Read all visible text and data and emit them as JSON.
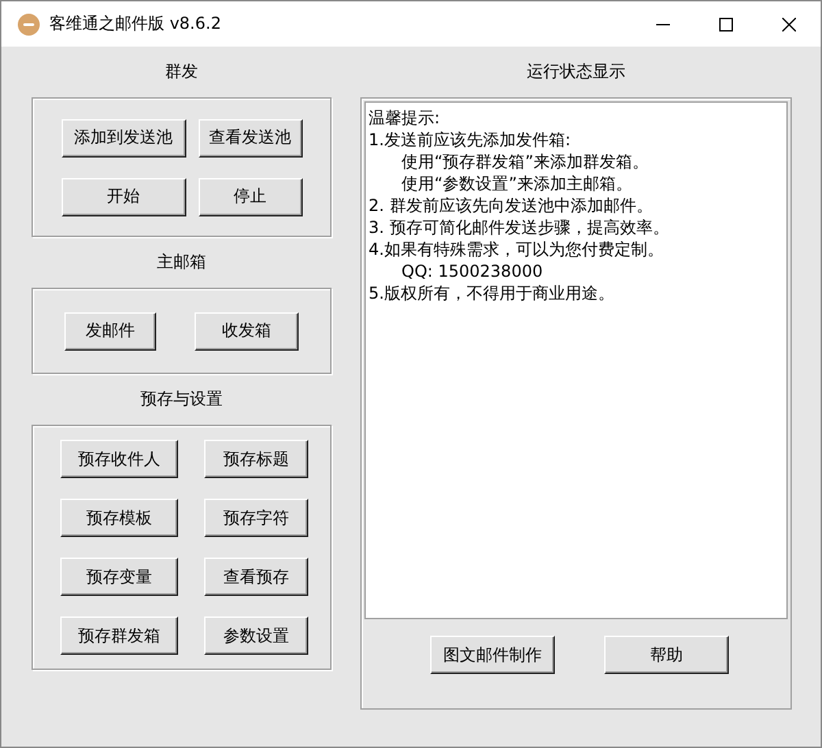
{
  "window": {
    "title": "客维通之邮件版 v8.6.2"
  },
  "left_groups": [
    {
      "title": "群发",
      "buttons": [
        "添加到发送池",
        "查看发送池",
        "开始",
        "停止"
      ]
    },
    {
      "title": "主邮箱",
      "buttons": [
        "发邮件",
        "收发箱"
      ]
    },
    {
      "title": "预存与设置",
      "buttons": [
        "预存收件人",
        "预存标题",
        "预存模板",
        "预存字符",
        "预存变量",
        "查看预存",
        "预存群发箱",
        "参数设置"
      ]
    }
  ],
  "status_panel": {
    "title": "运行状态显示",
    "log_lines": [
      {
        "text": "温馨提示:",
        "indented": false
      },
      {
        "text": "1.发送前应该先添加发件箱:",
        "indented": false
      },
      {
        "text": "使用“预存群发箱”来添加群发箱。",
        "indented": true
      },
      {
        "text": "使用“参数设置”来添加主邮箱。",
        "indented": true
      },
      {
        "text": "2. 群发前应该先向发送池中添加邮件。",
        "indented": false
      },
      {
        "text": "3. 预存可简化邮件发送步骤，提高效率。",
        "indented": false
      },
      {
        "text": "4.如果有特殊需求，可以为您付费定制。",
        "indented": false
      },
      {
        "text": "QQ: 1500238000",
        "indented": true
      },
      {
        "text": "5.版权所有，不得用于商业用途。",
        "indented": false
      }
    ],
    "buttons": [
      "图文邮件制作",
      "帮助"
    ]
  }
}
